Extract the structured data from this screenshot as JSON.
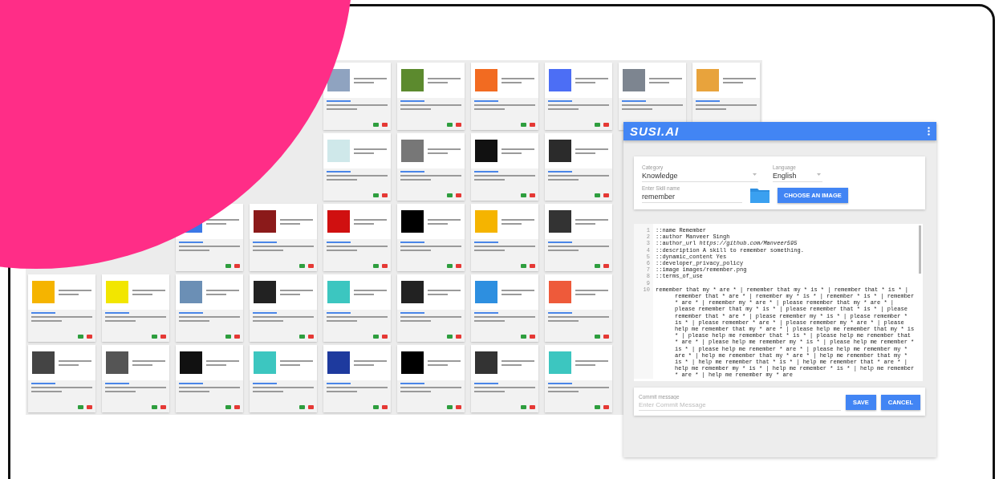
{
  "skill_grid": {
    "rows": [
      {
        "cards": [
          {
            "kind": "covered"
          },
          {
            "kind": "covered"
          },
          {
            "kind": "covered"
          },
          {
            "kind": "covered"
          },
          {
            "kind": "card",
            "color": "#8fa3c0"
          },
          {
            "kind": "card",
            "color": "#5c8a2e"
          },
          {
            "kind": "card",
            "color": "#f26b21"
          },
          {
            "kind": "card",
            "color": "#4c6ef5"
          },
          {
            "kind": "card",
            "color": "#7d8590"
          },
          {
            "kind": "card",
            "color": "#e8a33c"
          }
        ]
      },
      {
        "cards": [
          {
            "kind": "covered"
          },
          {
            "kind": "covered"
          },
          {
            "kind": "covered"
          },
          {
            "kind": "covered"
          },
          {
            "kind": "card",
            "color": "#cfe8ea"
          },
          {
            "kind": "card",
            "color": "#777777"
          },
          {
            "kind": "card",
            "color": "#111111"
          },
          {
            "kind": "card",
            "color": "#2b2b2b"
          },
          {
            "kind": "covered"
          },
          {
            "kind": "covered"
          }
        ]
      },
      {
        "cards": [
          {
            "kind": "covered"
          },
          {
            "kind": "covered"
          },
          {
            "kind": "card",
            "color": "#3b78e7"
          },
          {
            "kind": "card",
            "color": "#8b1a1a"
          },
          {
            "kind": "card",
            "color": "#d01010"
          },
          {
            "kind": "card",
            "color": "#000000"
          },
          {
            "kind": "card",
            "color": "#f5b400"
          },
          {
            "kind": "card",
            "color": "#333333"
          },
          {
            "kind": "covered"
          },
          {
            "kind": "covered"
          }
        ]
      },
      {
        "cards": [
          {
            "kind": "card",
            "color": "#f5b400"
          },
          {
            "kind": "card",
            "color": "#f2e600"
          },
          {
            "kind": "card",
            "color": "#6b8fb5"
          },
          {
            "kind": "card",
            "color": "#222222"
          },
          {
            "kind": "card",
            "color": "#3cc6c0"
          },
          {
            "kind": "card",
            "color": "#222222"
          },
          {
            "kind": "card",
            "color": "#2d8fe0"
          },
          {
            "kind": "card",
            "color": "#ee5a3a"
          },
          {
            "kind": "covered"
          },
          {
            "kind": "covered"
          }
        ]
      },
      {
        "cards": [
          {
            "kind": "card",
            "color": "#444444"
          },
          {
            "kind": "card",
            "color": "#555555"
          },
          {
            "kind": "card",
            "color": "#111111"
          },
          {
            "kind": "card",
            "color": "#3cc6c0"
          },
          {
            "kind": "card",
            "color": "#1e3a9e"
          },
          {
            "kind": "card",
            "color": "#000000"
          },
          {
            "kind": "card",
            "color": "#333333"
          },
          {
            "kind": "card",
            "color": "#3cc6c0"
          },
          {
            "kind": "covered"
          },
          {
            "kind": "covered"
          }
        ]
      }
    ]
  },
  "editor_window": {
    "logo": "SUSI.AI",
    "category": {
      "label": "Category",
      "value": "Knowledge"
    },
    "language": {
      "label": "Language",
      "value": "English"
    },
    "skill_name": {
      "label": "Enter Skill name",
      "value": "remember"
    },
    "choose_image_button": "CHOOSE AN IMAGE",
    "code_lines": [
      {
        "number": "1",
        "text": "::name Remember"
      },
      {
        "number": "2",
        "text": "::author Manveer Singh"
      },
      {
        "number": "3",
        "text": "::author_url *https://github.com/Manveer595*"
      },
      {
        "number": "4",
        "text": "::description A skill to remember something."
      },
      {
        "number": "5",
        "text": "::dynamic_content Yes"
      },
      {
        "number": "6",
        "text": "::developer_privacy_policy"
      },
      {
        "number": "7",
        "text": "::image images/remember.png"
      },
      {
        "number": "8",
        "text": "::terms_of_use"
      },
      {
        "number": "9"
      },
      {
        "number": "10",
        "text": "remember that my * are * | remember that my * is * | remember that * is * | remember that * are * | remember my * is * | remember * is * | remember * are * | remember my * are * | please remember that my * are * | please remember that my * is * | please remember that * is * | please remember that * are * | please remember my * is * | please remember * is * | please remember * are * | please remember my * are * | please help me remember that my * are * | please help me remember that my * is * | please help me remember that * is * | please help me remember that * are * | please help me remember my * is * | please help me remember * is * | please help me remember * are * | please help me remember my * are * | help me remember that my * are * | help me remember that my * is * | help me remember that * is * | help me remember that * are * | help me remember my * is * | help me remember * is * | help me remember * are * | help me remember my * are"
      }
    ],
    "commit": {
      "label": "Commit message",
      "placeholder": "Enter Commit Message"
    },
    "buttons": [
      "SAVE",
      "CANCEL"
    ]
  }
}
